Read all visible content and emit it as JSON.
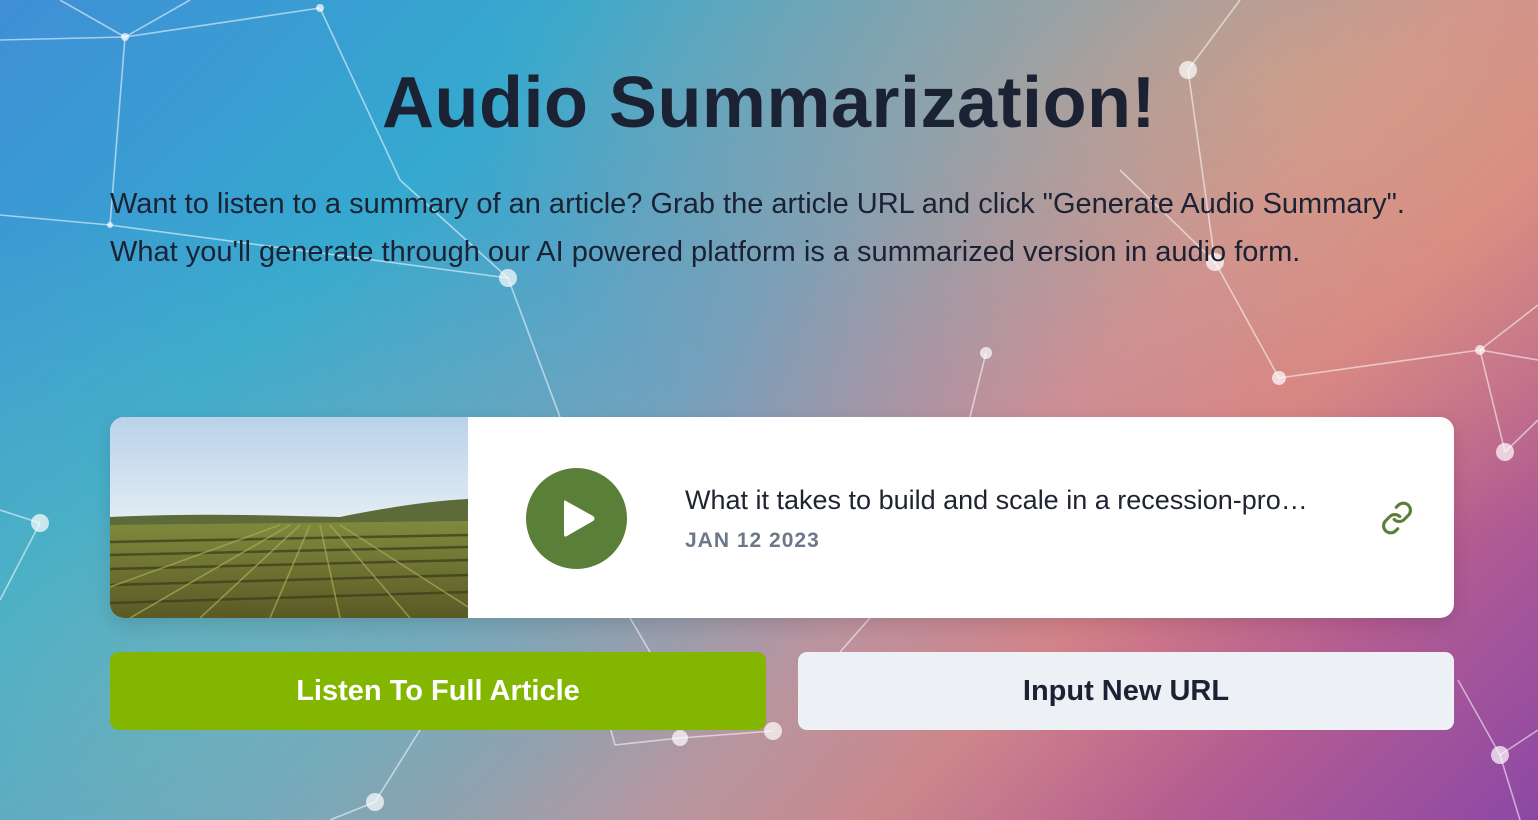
{
  "header": {
    "title": "Audio Summarization!",
    "description": "Want to listen to a summary of an article? Grab the article URL and click \"Generate Audio Summary\". What you'll generate through our AI powered platform is a summarized version in audio form."
  },
  "article": {
    "title": "What it takes to build and scale in a recession-pro…",
    "date": "JAN 12 2023",
    "thumbnail_icon": "farm-field-image",
    "play_icon": "play-icon",
    "link_icon": "link-icon"
  },
  "actions": {
    "listen_label": "Listen To Full Article",
    "new_url_label": "Input New URL"
  },
  "colors": {
    "accent_green": "#82b600",
    "play_green": "#5a7f38",
    "title_dark": "#1b2233",
    "date_gray": "#6d7888",
    "secondary_button_bg": "#edf1f6"
  }
}
